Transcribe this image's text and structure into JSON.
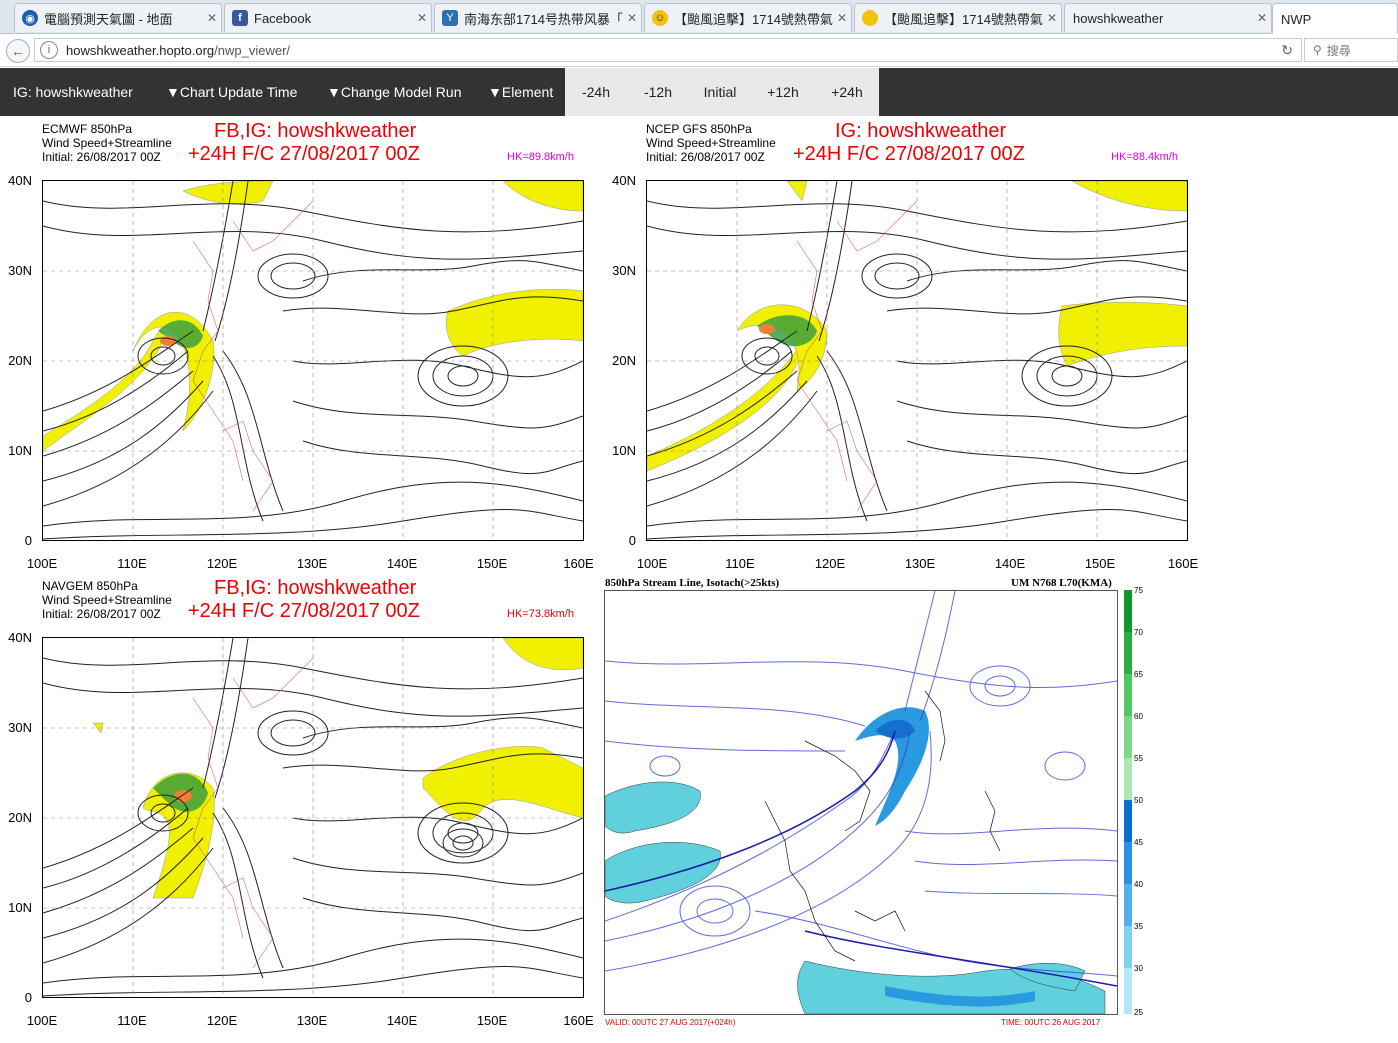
{
  "browser": {
    "tabs": [
      {
        "label": "電腦預測天氣圖 - 地面",
        "icon": "globe-icon",
        "color": "#1a5fb4"
      },
      {
        "label": "Facebook",
        "icon": "facebook-icon",
        "color": "#3b5998"
      },
      {
        "label": "南海东部1714号热带风暴「...",
        "icon": "weibo-icon",
        "color": "#2f6fb0"
      },
      {
        "label": "【颱風追擊】1714號熱帶氣...",
        "icon": "smiley-icon",
        "color": "#f4c20d"
      },
      {
        "label": "【颱風追擊】1714號熱帶氣...",
        "icon": "yellow-circle-icon",
        "color": "#f4c20d"
      },
      {
        "label": "howshkweather",
        "icon": "",
        "color": ""
      },
      {
        "label": "NWP",
        "icon": "",
        "color": ""
      }
    ],
    "url_host": "howshkweather.hopto.org",
    "url_path": "/nwp_viewer/",
    "search_placeholder": "搜尋"
  },
  "nav": {
    "brand": "IG: howshkweather",
    "menu": [
      "▼Chart Update Time",
      "▼Change Model Run",
      "▼Element"
    ],
    "hours": [
      "-24h",
      "-12h",
      "Initial",
      "+12h",
      "+24h"
    ]
  },
  "charts": [
    {
      "model": "ECMWF 850hPa",
      "desc": "Wind Speed+Streamline",
      "init": "Initial: 26/08/2017 00Z",
      "brand": "FB,IG: howshkweather",
      "fc": "+24H F/C 27/08/2017 00Z",
      "hk": "HK=89.8km/h",
      "hk_color": "#e000e0"
    },
    {
      "model": "NCEP GFS 850hPa",
      "desc": "Wind Speed+Streamline",
      "init": "Initial: 26/08/2017 00Z",
      "brand": "IG: howshkweather",
      "fc": "+24H F/C 27/08/2017 00Z",
      "hk": "HK=88.4km/h",
      "hk_color": "#e000e0"
    },
    {
      "model": "NAVGEM 850hPa",
      "desc": "Wind Speed+Streamline",
      "init": "Initial: 26/08/2017 00Z",
      "brand": "FB,IG: howshkweather",
      "fc": "+24H F/C 27/08/2017 00Z",
      "hk": "HK=73.8km/h",
      "hk_color": "#e00000"
    }
  ],
  "axes": {
    "lat": [
      "40N",
      "30N",
      "20N",
      "10N",
      "0"
    ],
    "lon": [
      "100E",
      "110E",
      "120E",
      "130E",
      "140E",
      "150E",
      "160E"
    ]
  },
  "kma": {
    "title_left": "850hPa Stream Line, Isotach(>25kts)",
    "title_right": "UM N768 L70(KMA)",
    "valid": "VALID: 00UTC 27 AUG 2017(+024h)",
    "time": "TIME: 00UTC 26 AUG 2017",
    "scale": [
      "75",
      "70",
      "65",
      "60",
      "55",
      "50",
      "45",
      "40",
      "35",
      "30",
      "25"
    ]
  }
}
